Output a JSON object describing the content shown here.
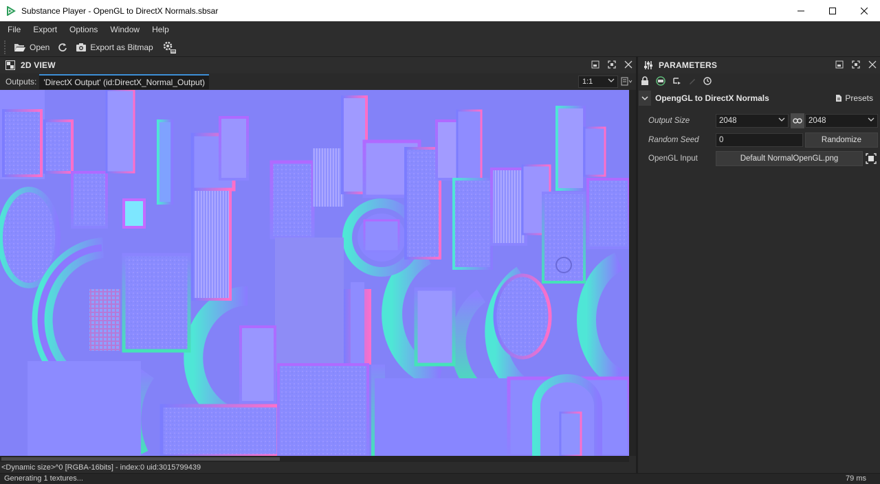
{
  "window": {
    "title": "Substance Player - OpenGL to DirectX Normals.sbsar"
  },
  "menu": {
    "items": [
      "File",
      "Export",
      "Options",
      "Window",
      "Help"
    ]
  },
  "toolbar": {
    "open_label": "Open",
    "export_label": "Export as Bitmap"
  },
  "view2d": {
    "title": "2D VIEW",
    "outputs_label": "Outputs:",
    "output_tab": "'DirectX Output' (id:DirectX_Normal_Output)",
    "zoom": "1:1",
    "info": "<Dynamic size>^0 [RGBA-16bits] - index:0 uid:3015799439"
  },
  "status": {
    "message": "Generating 1 textures...",
    "timing": "79 ms"
  },
  "parameters": {
    "title": "PARAMETERS",
    "group_title": "OpengGL to DirectX Normals",
    "presets_label": "Presets",
    "rows": {
      "output_size_label": "Output Size",
      "output_size_w": "2048",
      "output_size_h": "2048",
      "random_seed_label": "Random Seed",
      "random_seed_value": "0",
      "randomize_label": "Randomize",
      "opengl_input_label": "OpenGL Input",
      "opengl_input_value": "Default NormalOpenGL.png"
    }
  },
  "colors": {
    "normal_flat": "#8080ff",
    "accent": "#3d8fd6"
  }
}
